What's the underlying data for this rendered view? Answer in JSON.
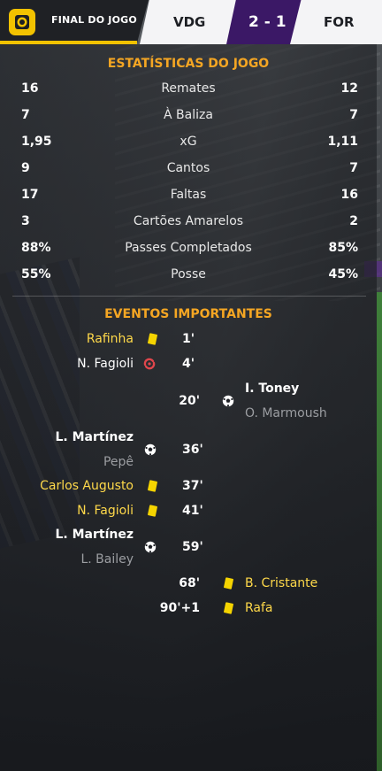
{
  "header": {
    "status": "FINAL DO JOGO",
    "home_team": "VDG",
    "away_team": "FOR",
    "score": "2 - 1"
  },
  "colors": {
    "accent": "#f5a623",
    "competition_yellow": "#f2c200",
    "score_bg": "#3b1866",
    "yellow_card": "#f5d400"
  },
  "stats": {
    "title": "ESTATÍSTICAS DO JOGO",
    "rows": [
      {
        "home": "16",
        "label": "Remates",
        "away": "12"
      },
      {
        "home": "7",
        "label": "À Baliza",
        "away": "7"
      },
      {
        "home": "1,95",
        "label": "xG",
        "away": "1,11"
      },
      {
        "home": "9",
        "label": "Cantos",
        "away": "7"
      },
      {
        "home": "17",
        "label": "Faltas",
        "away": "16"
      },
      {
        "home": "3",
        "label": "Cartões Amarelos",
        "away": "2"
      },
      {
        "home": "88%",
        "label": "Passes Completados",
        "away": "85%"
      },
      {
        "home": "55%",
        "label": "Posse",
        "away": "45%"
      }
    ]
  },
  "events": {
    "title": "EVENTOS IMPORTANTES",
    "items": [
      {
        "side": "home",
        "type": "yellow-card",
        "minute": "1'",
        "player": "Rafinha"
      },
      {
        "side": "home",
        "type": "injury",
        "minute": "4'",
        "player": "N. Fagioli"
      },
      {
        "side": "away",
        "type": "goal",
        "minute": "20'",
        "player": "I. Toney",
        "assist": "O. Marmoush"
      },
      {
        "side": "home",
        "type": "goal",
        "minute": "36'",
        "player": "L. Martínez",
        "assist": "Pepê"
      },
      {
        "side": "home",
        "type": "yellow-card",
        "minute": "37'",
        "player": "Carlos Augusto"
      },
      {
        "side": "home",
        "type": "yellow-card",
        "minute": "41'",
        "player": "N. Fagioli"
      },
      {
        "side": "home",
        "type": "goal",
        "minute": "59'",
        "player": "L. Martínez",
        "assist": "L. Bailey"
      },
      {
        "side": "away",
        "type": "yellow-card",
        "minute": "68'",
        "player": "B. Cristante"
      },
      {
        "side": "away",
        "type": "yellow-card",
        "minute": "90'+1",
        "player": "Rafa"
      }
    ]
  }
}
